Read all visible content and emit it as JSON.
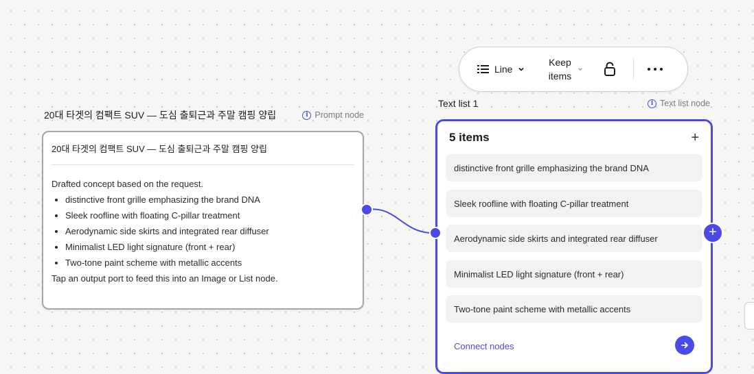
{
  "colors": {
    "accent": "#4a4ae6",
    "canvas": "#f6f6f5",
    "card_border": "#a6a6a6"
  },
  "prompt_node": {
    "title": "20대 타겟의 컴팩트 SUV — 도심 출퇴근과 주말 캠핑 양립",
    "type_label": "Prompt node",
    "card_title": "20대 타겟의 컴팩트 SUV — 도심 출퇴근과 주말 캠핑 양립",
    "intro": "Drafted concept based on the request.",
    "bullets": [
      "distinctive front grille emphasizing the brand DNA",
      "Sleek roofline with floating C-pillar treatment",
      "Aerodynamic side skirts and integrated rear diffuser",
      "Minimalist LED light signature (front + rear)",
      "Two-tone paint scheme with metallic accents"
    ],
    "footer": "Tap an output port to feed this into an Image or List node."
  },
  "toolbar": {
    "line_label": "Line",
    "keep_label": "Keep items",
    "icons": [
      "list-lines-icon",
      "chevron-down-icon",
      "lock-open-icon",
      "more-dots-icon"
    ]
  },
  "list_node": {
    "title": "Text list 1",
    "type_label": "Text list node",
    "count_label": "5 items",
    "add_label": "+",
    "items": [
      "distinctive front grille emphasizing the brand DNA",
      "Sleek roofline with floating C-pillar treatment",
      "Aerodynamic side skirts and integrated rear diffuser",
      "Minimalist LED light signature (front + rear)",
      "Two-tone paint scheme with metallic accents"
    ],
    "connect_label": "Connect nodes",
    "add_node_label": "+"
  }
}
